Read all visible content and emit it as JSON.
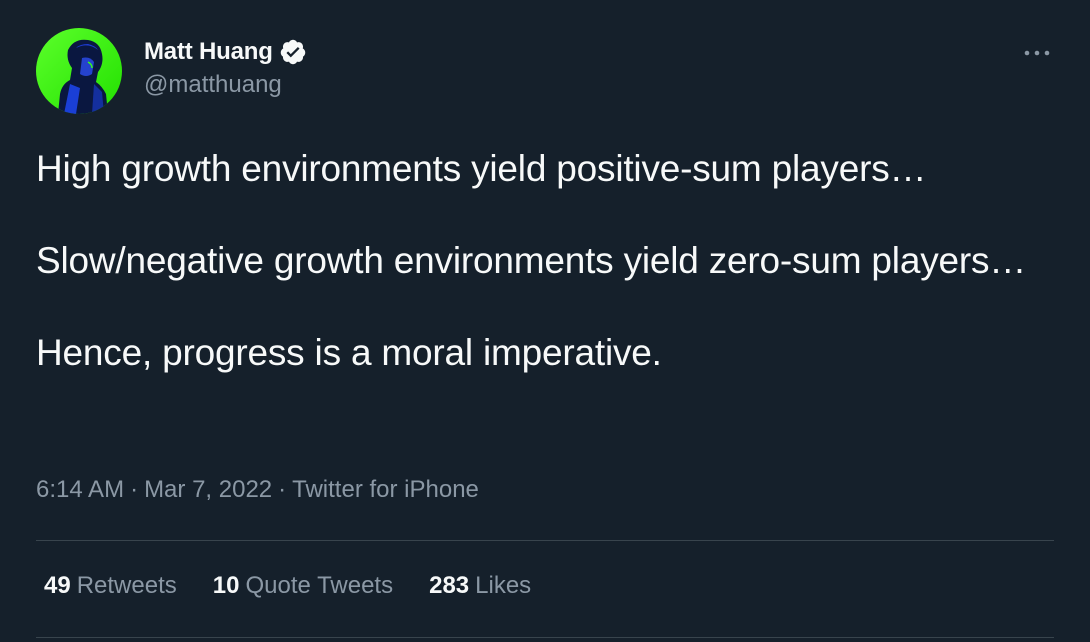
{
  "author": {
    "display_name": "Matt Huang",
    "handle": "@matthuang",
    "verified": true,
    "avatar_icon": "avatar-portrait-neon"
  },
  "more_icon": "ellipsis-icon",
  "tweet": {
    "paragraphs": [
      "High growth environments yield positive-sum players…",
      "Slow/negative growth environments yield zero-sum players…",
      "Hence, progress is a moral imperative."
    ]
  },
  "meta": {
    "time": "6:14 AM",
    "date": "Mar 7, 2022",
    "source": "Twitter for iPhone",
    "separator": "·"
  },
  "stats": {
    "retweets": {
      "count": "49",
      "label": "Retweets"
    },
    "quotes": {
      "count": "10",
      "label": "Quote Tweets"
    },
    "likes": {
      "count": "283",
      "label": "Likes"
    }
  },
  "colors": {
    "background": "#15202b",
    "text_primary": "#f7f9f9",
    "text_secondary": "#8b98a5",
    "divider": "#38444d",
    "avatar_green": "#39ff14",
    "avatar_blue": "#1a3fd6"
  }
}
